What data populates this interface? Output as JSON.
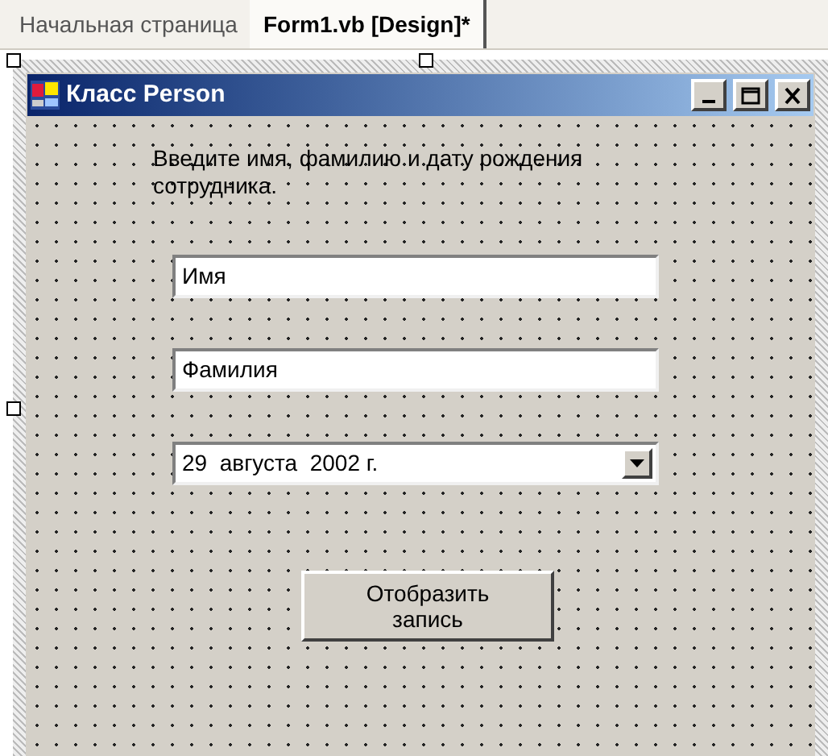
{
  "tabs": [
    {
      "label": "Начальная страница",
      "selected": false
    },
    {
      "label": "Form1.vb [Design]*",
      "selected": true
    }
  ],
  "window": {
    "title": "Класс Person"
  },
  "prompt": "Введите имя, фамилию и дату рождения сотрудника.",
  "fields": [
    {
      "kind": "text",
      "value": "Имя"
    },
    {
      "kind": "text",
      "value": "Фамилия"
    },
    {
      "kind": "date",
      "value": "29  августа  2002 г."
    }
  ],
  "button": "Отобразить запись"
}
